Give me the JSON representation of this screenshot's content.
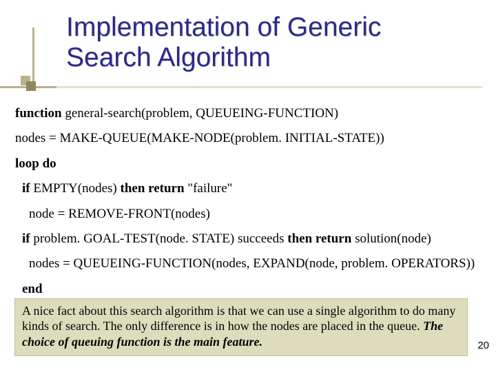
{
  "title_line1": "Implementation of Generic",
  "title_line2": "Search Algorithm",
  "code": {
    "l1a": "function",
    "l1b": " general-search(problem, QUEUEING-FUNCTION)",
    "l2": "nodes = MAKE-QUEUE(MAKE-NODE(problem. INITIAL-STATE))",
    "l3": "loop do",
    "l4a": "if",
    "l4b": " EMPTY(nodes) ",
    "l4c": "then return",
    "l4d": " \"failure\"",
    "l5": "node = REMOVE-FRONT(nodes)",
    "l6a": "if",
    "l6b": " problem. GOAL-TEST(node. STATE) succeeds ",
    "l6c": "then return",
    "l6d": " solution(node)",
    "l7": "nodes = QUEUEING-FUNCTION(nodes, EXPAND(node, problem. OPERATORS))",
    "l8": "end"
  },
  "note": {
    "body": "A nice fact about this search algorithm is that we can use a single algorithm to do many kinds of search. The only difference is in how the nodes are placed in the queue. ",
    "emph": "The choice of queuing function is the main feature."
  },
  "page_number": "20"
}
